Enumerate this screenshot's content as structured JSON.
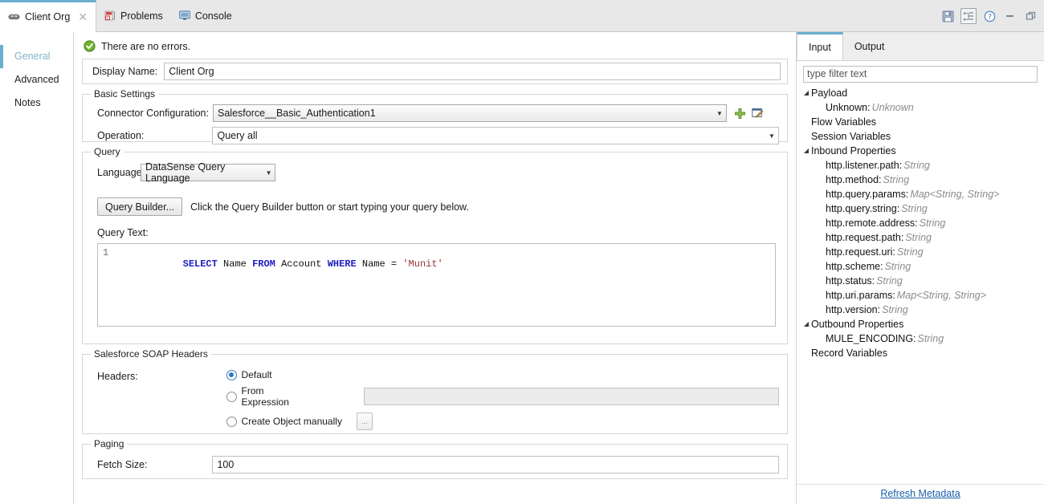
{
  "window": {
    "tabs": [
      {
        "label": "Client Org",
        "icon": "connector-icon",
        "active": true,
        "closable": true
      },
      {
        "label": "Problems",
        "icon": "problems-icon",
        "active": false,
        "closable": false
      },
      {
        "label": "Console",
        "icon": "console-icon",
        "active": false,
        "closable": false
      }
    ],
    "toolbar": [
      {
        "name": "save-icon",
        "title": "Save"
      },
      {
        "name": "outline-tree-icon",
        "title": "Outline",
        "framed": true
      },
      {
        "name": "help-icon",
        "title": "Help"
      },
      {
        "name": "minimize-icon",
        "title": "Minimize"
      },
      {
        "name": "maximize-icon",
        "title": "Maximize"
      }
    ]
  },
  "sidebar": {
    "items": [
      {
        "label": "General",
        "active": true
      },
      {
        "label": "Advanced",
        "active": false
      },
      {
        "label": "Notes",
        "active": false
      }
    ]
  },
  "editor": {
    "status": {
      "text": "There are no errors.",
      "icon": "success-check-icon",
      "color": "#5aa02c"
    },
    "display_name": {
      "label": "Display Name:",
      "value": "Client Org"
    },
    "basic_settings": {
      "title": "Basic Settings",
      "connector_configuration": {
        "label": "Connector Configuration:",
        "value": "Salesforce__Basic_Authentication1"
      },
      "add_button": "add-config-icon",
      "edit_button": "edit-config-icon",
      "operation": {
        "label": "Operation:",
        "value": "Query all"
      }
    },
    "query": {
      "title": "Query",
      "language": {
        "label": "Language:",
        "value": "DataSense Query Language"
      },
      "query_builder_button": "Query Builder...",
      "query_builder_hint": "Click the Query Builder button or start typing your query below.",
      "query_text_label": "Query Text:",
      "code": {
        "line_number": "1",
        "tokens": [
          {
            "t": "SELECT",
            "k": "kw"
          },
          {
            "t": " ",
            "k": "op"
          },
          {
            "t": "Name",
            "k": "id"
          },
          {
            "t": " ",
            "k": "op"
          },
          {
            "t": "FROM",
            "k": "kw"
          },
          {
            "t": " ",
            "k": "op"
          },
          {
            "t": "Account",
            "k": "id"
          },
          {
            "t": " ",
            "k": "op"
          },
          {
            "t": "WHERE",
            "k": "kw"
          },
          {
            "t": " ",
            "k": "op"
          },
          {
            "t": "Name",
            "k": "id"
          },
          {
            "t": " = ",
            "k": "op"
          },
          {
            "t": "'Munit'",
            "k": "str"
          }
        ]
      }
    },
    "soap_headers": {
      "title": "Salesforce SOAP Headers",
      "headers_label": "Headers:",
      "options": [
        {
          "label": "Default",
          "selected": true
        },
        {
          "label": "From Expression",
          "selected": false
        },
        {
          "label": "Create Object manually",
          "selected": false
        }
      ],
      "expression_value": "",
      "create_object_button": "..."
    },
    "paging": {
      "title": "Paging",
      "fetch_size": {
        "label": "Fetch Size:",
        "value": "100"
      }
    }
  },
  "metadata_panel": {
    "tabs": [
      {
        "label": "Input",
        "active": true
      },
      {
        "label": "Output",
        "active": false
      }
    ],
    "filter_placeholder": "type filter text",
    "tree": [
      {
        "depth": 0,
        "twist": "expanded",
        "label": "Payload",
        "type": ""
      },
      {
        "depth": 1,
        "twist": "none",
        "label": "Unknown",
        "type": "Unknown"
      },
      {
        "depth": 0,
        "twist": "none",
        "label": "Flow Variables",
        "type": ""
      },
      {
        "depth": 0,
        "twist": "none",
        "label": "Session Variables",
        "type": ""
      },
      {
        "depth": 0,
        "twist": "expanded",
        "label": "Inbound Properties",
        "type": ""
      },
      {
        "depth": 1,
        "twist": "none",
        "label": "http.listener.path",
        "type": "String"
      },
      {
        "depth": 1,
        "twist": "none",
        "label": "http.method",
        "type": "String"
      },
      {
        "depth": 1,
        "twist": "none",
        "label": "http.query.params",
        "type": "Map<String, String>"
      },
      {
        "depth": 1,
        "twist": "none",
        "label": "http.query.string",
        "type": "String"
      },
      {
        "depth": 1,
        "twist": "none",
        "label": "http.remote.address",
        "type": "String"
      },
      {
        "depth": 1,
        "twist": "none",
        "label": "http.request.path",
        "type": "String"
      },
      {
        "depth": 1,
        "twist": "none",
        "label": "http.request.uri",
        "type": "String"
      },
      {
        "depth": 1,
        "twist": "none",
        "label": "http.scheme",
        "type": "String"
      },
      {
        "depth": 1,
        "twist": "none",
        "label": "http.status",
        "type": "String"
      },
      {
        "depth": 1,
        "twist": "none",
        "label": "http.uri.params",
        "type": "Map<String, String>"
      },
      {
        "depth": 1,
        "twist": "none",
        "label": "http.version",
        "type": "String"
      },
      {
        "depth": 0,
        "twist": "expanded",
        "label": "Outbound Properties",
        "type": ""
      },
      {
        "depth": 1,
        "twist": "none",
        "label": "MULE_ENCODING",
        "type": "String"
      },
      {
        "depth": 0,
        "twist": "none",
        "label": "Record Variables",
        "type": ""
      }
    ],
    "refresh_link": "Refresh Metadata"
  },
  "colors": {
    "accent": "#6aaed0",
    "active_nav_text": "#7fb5cb",
    "success": "#5aa02c",
    "link": "#1a5fa8",
    "keyword": "#2020c0",
    "string": "#9a3232"
  }
}
